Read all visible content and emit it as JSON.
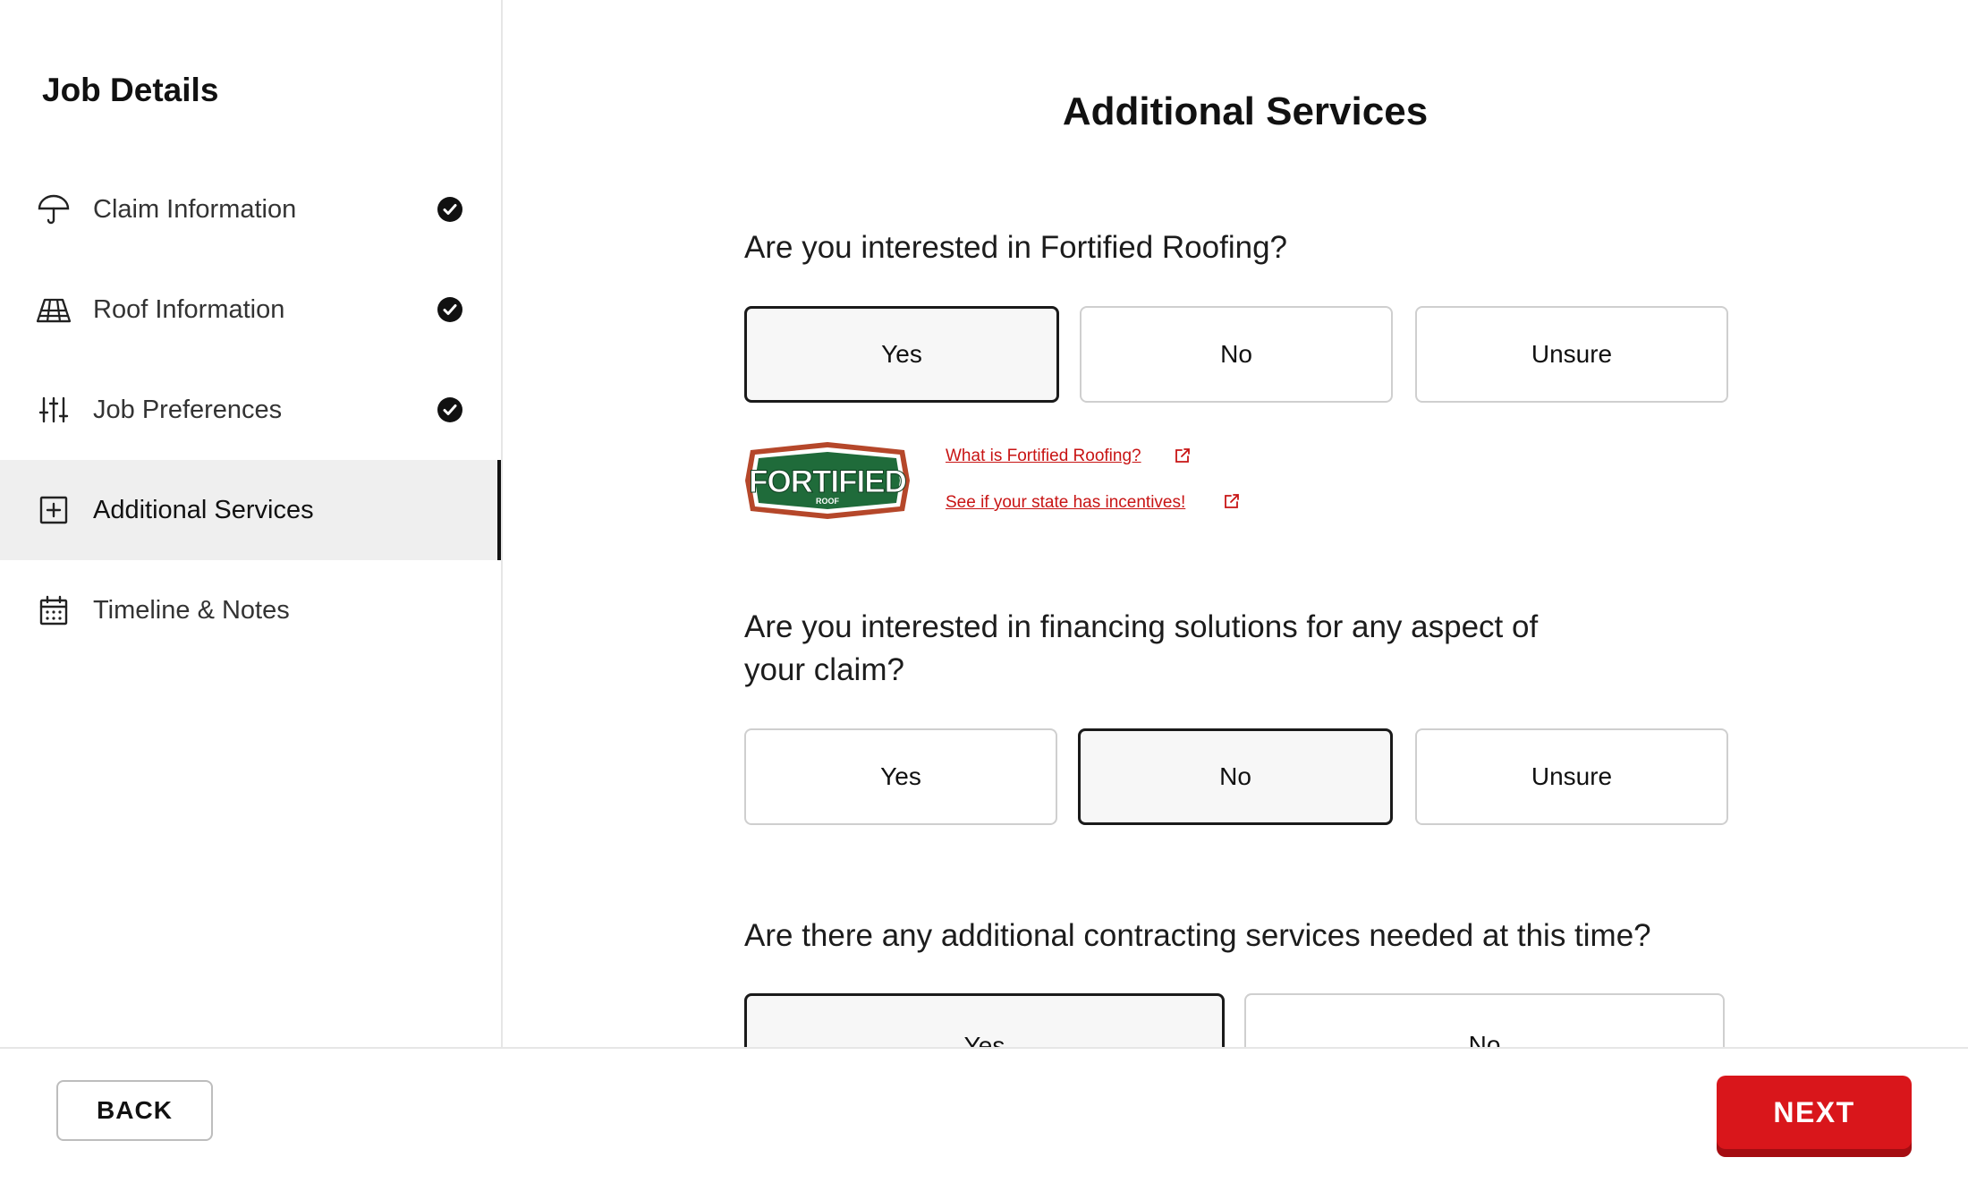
{
  "sidebar": {
    "title": "Job Details",
    "items": [
      {
        "label": "Claim Information",
        "icon": "umbrella-icon",
        "completed": true,
        "active": false
      },
      {
        "label": "Roof Information",
        "icon": "roof-icon",
        "completed": true,
        "active": false
      },
      {
        "label": "Job Preferences",
        "icon": "sliders-icon",
        "completed": true,
        "active": false
      },
      {
        "label": "Additional Services",
        "icon": "plus-square-icon",
        "completed": false,
        "active": true
      },
      {
        "label": "Timeline & Notes",
        "icon": "calendar-icon",
        "completed": false,
        "active": false
      }
    ]
  },
  "main": {
    "title": "Additional Services",
    "q1": {
      "text": "Are you interested in Fortified Roofing?",
      "options": [
        "Yes",
        "No",
        "Unsure"
      ],
      "selected": "Yes"
    },
    "fortified": {
      "logo_text": "FORTIFIED",
      "logo_subtext": "ROOF",
      "link1": "What is Fortified Roofing?",
      "link2": "See if your state has incentives!"
    },
    "q2": {
      "line1": "Are you interested in financing solutions for any aspect of",
      "line2": "your claim?",
      "options": [
        "Yes",
        "No",
        "Unsure"
      ],
      "selected": "No"
    },
    "q3": {
      "text": "Are there any additional contracting services needed at this time?",
      "options": [
        "Yes",
        "No"
      ],
      "selected": "Yes"
    }
  },
  "footer": {
    "back_label": "BACK",
    "next_label": "NEXT"
  },
  "colors": {
    "accent": "#d9161b",
    "link": "#c81414",
    "logo_green": "#1f6b3a",
    "logo_border": "#b5472a"
  }
}
